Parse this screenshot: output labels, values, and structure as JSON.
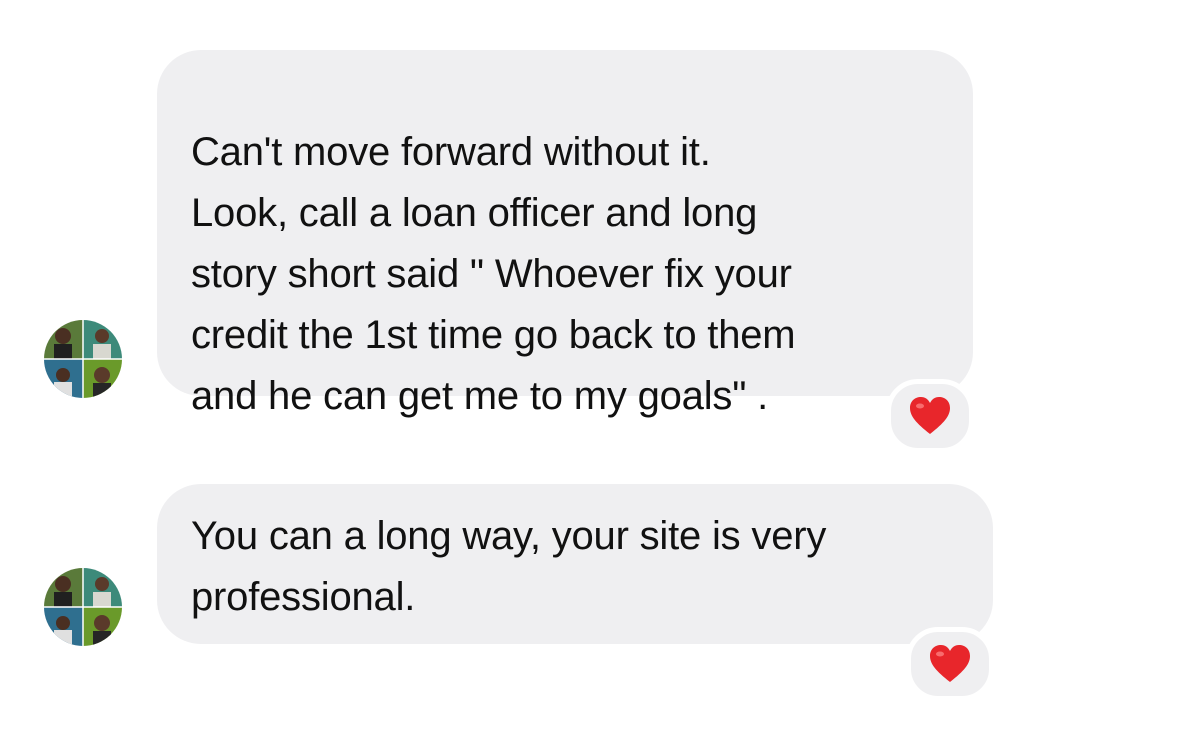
{
  "conversation": {
    "messages": [
      {
        "text": "Can't move forward without it.\nLook, call a loan officer and long\nstory short said \" Whoever fix your\ncredit the 1st time go back to them\nand he can get me to my goals\" .",
        "reaction_icon": "red-heart-icon"
      },
      {
        "text": "You can a long way, your site is very\nprofessional.",
        "reaction_icon": "red-heart-icon"
      }
    ]
  },
  "colors": {
    "bubble_background": "#efeff1",
    "text": "#111111",
    "heart": "#e8262b",
    "page_background": "#ffffff"
  }
}
